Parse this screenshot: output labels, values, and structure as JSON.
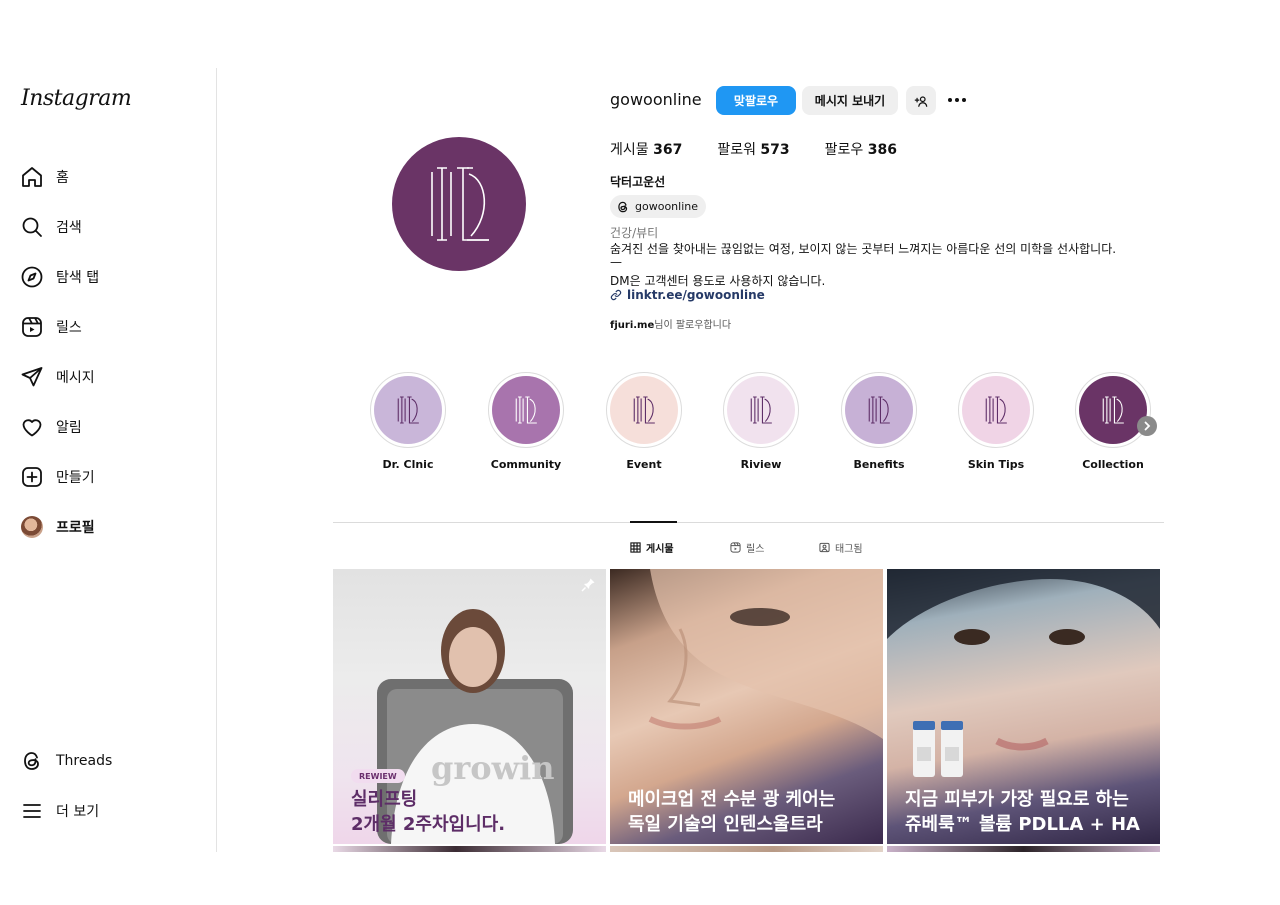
{
  "sidebar": {
    "logo": "Instagram",
    "items": [
      {
        "label": "홈",
        "icon": "home-icon"
      },
      {
        "label": "검색",
        "icon": "search-icon"
      },
      {
        "label": "탐색 탭",
        "icon": "compass-icon"
      },
      {
        "label": "릴스",
        "icon": "reels-icon"
      },
      {
        "label": "메시지",
        "icon": "send-icon"
      },
      {
        "label": "알림",
        "icon": "heart-icon"
      },
      {
        "label": "만들기",
        "icon": "plus-square-icon"
      },
      {
        "label": "프로필",
        "icon": "avatar"
      }
    ],
    "bottom": [
      {
        "label": "Threads",
        "icon": "threads-icon"
      },
      {
        "label": "더 보기",
        "icon": "menu-icon"
      }
    ]
  },
  "profile": {
    "username": "gowoonline",
    "follow_back_label": "맞팔로우",
    "message_label": "메시지 보내기",
    "add_label": "+오",
    "stats": {
      "posts_label": "게시물",
      "posts": "367",
      "followers_label": "팔로워",
      "followers": "573",
      "following_label": "팔로우",
      "following": "386"
    },
    "full_name": "닥터고운선",
    "threads_handle": "gowoonline",
    "category": "건강/뷰티",
    "bio_line1": "숨겨진 선을 찾아내는 끊임없는 여정, 보이지 않는 곳부터 느껴지는 아름다운 선의 미학을 선사합니다.",
    "bio_line2": "—",
    "bio_line3": "DM은 고객센터 용도로 사용하지 않습니다.",
    "link": "linktr.ee/gowoonline",
    "followed_by_name": "fjuri.me",
    "followed_by_suffix": "님이 팔로우합니다"
  },
  "highlights": [
    {
      "label": "Dr. Clnic",
      "color": "#c9b6d9"
    },
    {
      "label": "Community",
      "color": "#a874ad"
    },
    {
      "label": "Event",
      "color": "#f6dfda"
    },
    {
      "label": "Riview",
      "color": "#f1e2ee"
    },
    {
      "label": "Benefits",
      "color": "#c7b1d6"
    },
    {
      "label": "Skin Tips",
      "color": "#f0d4e6"
    },
    {
      "label": "Collection",
      "color": "#6a3466"
    }
  ],
  "tabs": [
    {
      "label": "게시물",
      "icon": "grid-icon",
      "active": true
    },
    {
      "label": "릴스",
      "icon": "reels-icon",
      "active": false
    },
    {
      "label": "태그됨",
      "icon": "tag-icon",
      "active": false
    }
  ],
  "posts": [
    {
      "tag": "REWIEW",
      "line1": "실리프팅",
      "line2": "2개월 2주차입니다.",
      "pinned": true
    },
    {
      "line1": "메이크업 전 수분 광 케어는",
      "line2": "독일 기술의 인텐스울트라"
    },
    {
      "line1": "지금 피부가 가장 필요로 하는",
      "line2": "쥬베룩™ 볼륨 PDLLA + HA"
    }
  ],
  "colors": {
    "brand_purple": "#6a3466",
    "follow_blue": "#1f97f3",
    "link_navy": "#263a67"
  }
}
